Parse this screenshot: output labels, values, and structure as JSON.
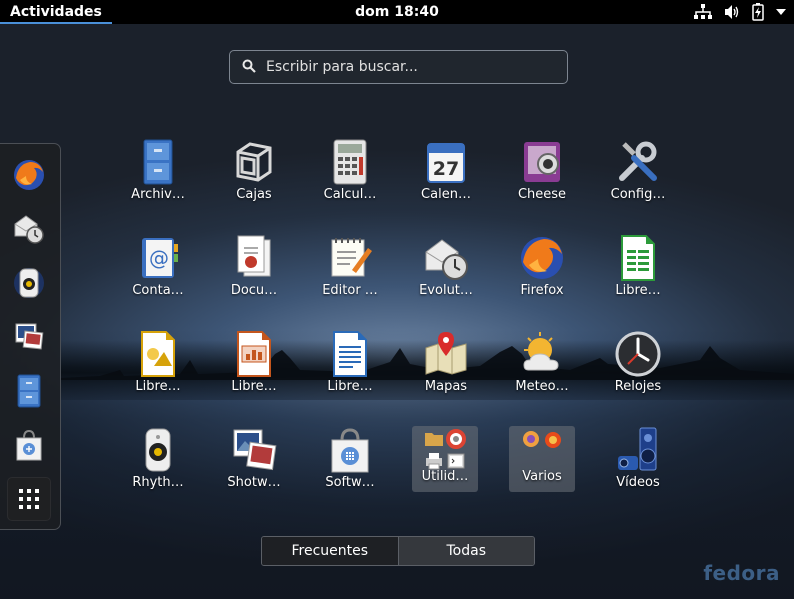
{
  "topbar": {
    "activities_label": "Actividades",
    "clock": "dom 18:40",
    "status_icons": [
      "network-wired-icon",
      "volume-icon",
      "battery-charging-icon",
      "system-menu-arrow-icon"
    ]
  },
  "search": {
    "placeholder": "Escribir para buscar...",
    "value": ""
  },
  "dash": {
    "items": [
      {
        "name": "Firefox",
        "icon": "firefox-icon"
      },
      {
        "name": "Evolution",
        "icon": "evolution-icon"
      },
      {
        "name": "Rhythmbox",
        "icon": "rhythmbox-icon"
      },
      {
        "name": "Shotwell",
        "icon": "shotwell-icon"
      },
      {
        "name": "Archivos",
        "icon": "files-icon"
      },
      {
        "name": "Software",
        "icon": "software-icon"
      }
    ],
    "show_apps_icon": "show-apps-grid-icon"
  },
  "apps": [
    {
      "label": "Archiv…",
      "icon": "files-icon"
    },
    {
      "label": "Cajas",
      "icon": "boxes-icon"
    },
    {
      "label": "Calcul…",
      "icon": "calculator-icon"
    },
    {
      "label": "Calen…",
      "icon": "calendar-icon",
      "calendar_day": "27"
    },
    {
      "label": "Cheese",
      "icon": "cheese-icon"
    },
    {
      "label": "Config…",
      "icon": "settings-tools-icon"
    },
    {
      "label": "Conta…",
      "icon": "contacts-icon"
    },
    {
      "label": "Docu…",
      "icon": "document-viewer-icon"
    },
    {
      "label": "Editor …",
      "icon": "text-editor-icon"
    },
    {
      "label": "Evolut…",
      "icon": "evolution-icon"
    },
    {
      "label": "Firefox",
      "icon": "firefox-icon"
    },
    {
      "label": "Libre…",
      "icon": "libreoffice-calc-icon"
    },
    {
      "label": "Libre…",
      "icon": "libreoffice-draw-icon"
    },
    {
      "label": "Libre…",
      "icon": "libreoffice-impress-icon"
    },
    {
      "label": "Libre…",
      "icon": "libreoffice-writer-icon"
    },
    {
      "label": "Mapas",
      "icon": "maps-icon"
    },
    {
      "label": "Meteo…",
      "icon": "weather-icon"
    },
    {
      "label": "Relojes",
      "icon": "clocks-icon"
    },
    {
      "label": "Rhyth…",
      "icon": "rhythmbox-icon"
    },
    {
      "label": "Shotw…",
      "icon": "shotwell-icon"
    },
    {
      "label": "Softw…",
      "icon": "software-icon"
    }
  ],
  "folders": [
    {
      "label": "Utilid…",
      "icons": [
        "folder-icon",
        "help-lifebuoy-icon",
        "printer-icon",
        "terminal-icon"
      ]
    },
    {
      "label": "Varios",
      "icons": [
        "firefox-old-icon",
        "alarm-icon"
      ]
    }
  ],
  "last_app": {
    "label": "Vídeos",
    "icon": "videos-icon"
  },
  "view_switch": {
    "frequent_label": "Frecuentes",
    "all_label": "Todas",
    "active": "Frecuentes"
  },
  "brand": {
    "logo_text": "fedora",
    "accent": "#4a90d9"
  }
}
